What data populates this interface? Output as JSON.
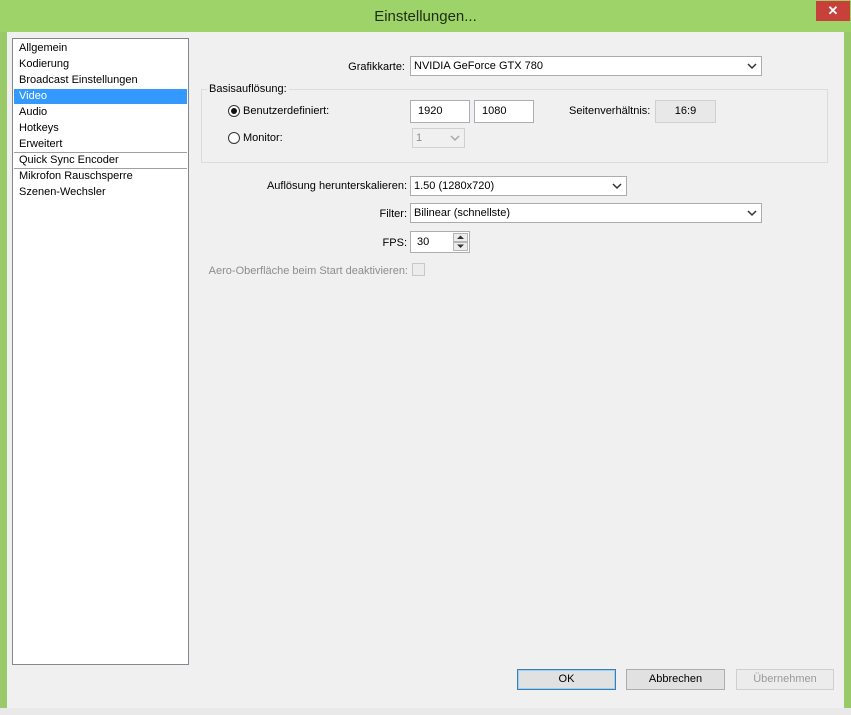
{
  "window": {
    "title": "Einstellungen...",
    "close_glyph": "✕"
  },
  "sidebar": {
    "items": [
      {
        "label": "Allgemein"
      },
      {
        "label": "Kodierung"
      },
      {
        "label": "Broadcast Einstellungen"
      },
      {
        "label": "Video",
        "selected": true
      },
      {
        "label": "Audio"
      },
      {
        "label": "Hotkeys"
      },
      {
        "label": "Erweitert"
      },
      {
        "label": "Quick Sync Encoder"
      },
      {
        "label": "Mikrofon Rauschsperre"
      },
      {
        "label": "Szenen-Wechsler"
      }
    ]
  },
  "video": {
    "graphics_card_label": "Grafikkarte:",
    "graphics_card_value": "NVIDIA GeForce GTX 780",
    "base_resolution_label": "Basisauflösung:",
    "custom_label": "Benutzerdefiniert:",
    "custom_selected": true,
    "width": "1920",
    "height": "1080",
    "aspect_label": "Seitenverhältnis:",
    "aspect_value": "16:9",
    "monitor_label": "Monitor:",
    "monitor_value": "1",
    "downscale_label": "Auflösung herunterskalieren:",
    "downscale_value": "1.50  (1280x720)",
    "filter_label": "Filter:",
    "filter_value": "Bilinear (schnellste)",
    "fps_label": "FPS:",
    "fps_value": "30",
    "aero_label": "Aero-Oberfläche beim Start deaktivieren:",
    "aero_checked": false
  },
  "buttons": {
    "ok": "OK",
    "cancel": "Abbrechen",
    "apply": "Übernehmen"
  }
}
